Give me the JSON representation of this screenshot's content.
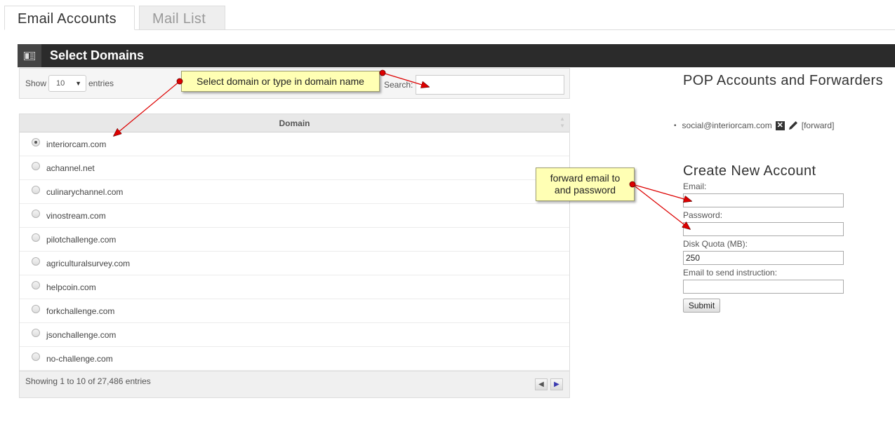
{
  "tabs": [
    {
      "label": "Email Accounts",
      "active": true
    },
    {
      "label": "Mail List",
      "active": false
    }
  ],
  "panel": {
    "title": "Select Domains",
    "icon": "list-icon"
  },
  "table_controls": {
    "show_label": "Show",
    "page_size": "10",
    "entries_label": "entries",
    "search_label": "Search:",
    "search_value": ""
  },
  "table": {
    "column_header": "Domain",
    "rows": [
      {
        "domain": "interiorcam.com",
        "selected": true
      },
      {
        "domain": "achannel.net",
        "selected": false
      },
      {
        "domain": "culinarychannel.com",
        "selected": false
      },
      {
        "domain": "vinostream.com",
        "selected": false
      },
      {
        "domain": "pilotchallenge.com",
        "selected": false
      },
      {
        "domain": "agriculturalsurvey.com",
        "selected": false
      },
      {
        "domain": "helpcoin.com",
        "selected": false
      },
      {
        "domain": "forkchallenge.com",
        "selected": false
      },
      {
        "domain": "jsonchallenge.com",
        "selected": false
      },
      {
        "domain": "no-challenge.com",
        "selected": false
      }
    ],
    "footer_info": "Showing 1 to 10 of 27,486 entries",
    "prev_icon": "prev-page-icon",
    "next_icon": "next-page-icon"
  },
  "pop": {
    "title": "POP Accounts and Forwarders",
    "accounts": [
      {
        "email": "social@interiorcam.com",
        "forward_label": "[forward]"
      }
    ]
  },
  "create": {
    "title": "Create New Account",
    "email_label": "Email:",
    "email_value": "",
    "password_label": "Password:",
    "password_value": "",
    "quota_label": "Disk Quota (MB):",
    "quota_value": "250",
    "instruction_label": "Email to send instruction:",
    "instruction_value": "",
    "submit_label": "Submit"
  },
  "callouts": {
    "domain_hint": "Select domain or type in domain name",
    "forward_hint_line1": "forward email to",
    "forward_hint_line2": "and password"
  },
  "colors": {
    "header_bg": "#2b2b2b",
    "callout_bg": "#ffffb4",
    "arrow": "#dd0000"
  }
}
